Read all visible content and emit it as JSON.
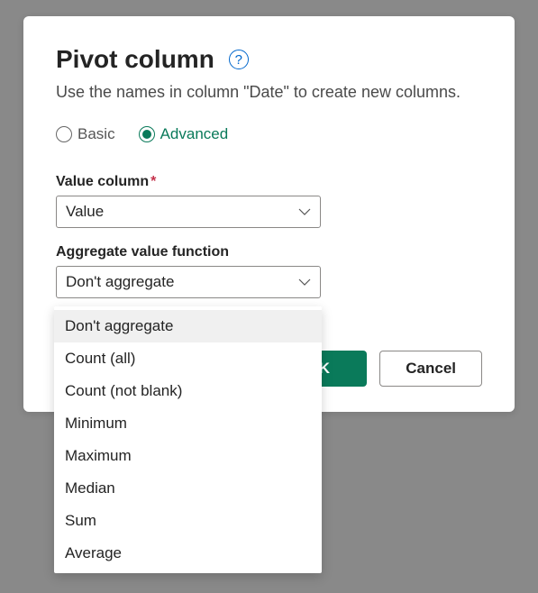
{
  "dialog": {
    "title": "Pivot column",
    "description": "Use the names in column \"Date\" to create new columns.",
    "help_icon": "?",
    "radio": {
      "basic": "Basic",
      "advanced": "Advanced",
      "selected": "advanced"
    },
    "value_column": {
      "label": "Value column",
      "required": "*",
      "value": "Value"
    },
    "aggregate": {
      "label": "Aggregate value function",
      "value": "Don't aggregate",
      "options": [
        "Don't aggregate",
        "Count (all)",
        "Count (not blank)",
        "Minimum",
        "Maximum",
        "Median",
        "Sum",
        "Average"
      ]
    },
    "buttons": {
      "ok": "OK",
      "cancel": "Cancel"
    }
  }
}
